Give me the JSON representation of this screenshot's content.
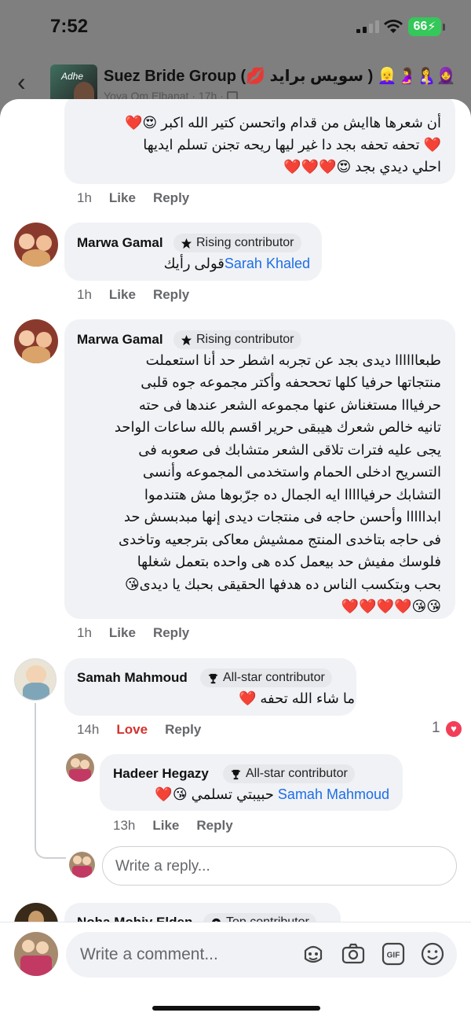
{
  "status": {
    "time": "7:52",
    "battery": "66"
  },
  "group": {
    "title": "Suez Bride Group (💋 سويس برايد ) 👱‍♀️🤰🤱🧕",
    "subtitle": "Yoya Om Elbanat · 17h · ",
    "thumb_text": "Adhe"
  },
  "comments": [
    {
      "lines": [
        "أن شعرها هاايش من قدام واتحسن كتير الله اكبر 😍❤️",
        "❤️ تحفه تحفه بجد دا غير ليها ريحه تجنن تسلم ايديها",
        "احلي ديدي بجد 😍❤️❤️❤️"
      ],
      "time": "1h",
      "like": "Like",
      "reply": "Reply"
    },
    {
      "author": "Marwa Gamal",
      "badge": "Rising contributor",
      "mention": "Sarah Khaled",
      "text": "قولى رأيك",
      "time": "1h",
      "like": "Like",
      "reply": "Reply"
    },
    {
      "author": "Marwa Gamal",
      "badge": "Rising contributor",
      "lines": [
        "طبعاااااا ديدى بجد عن تجربه اشطر حد أنا استعملت",
        "منتجاتها حرفيا كلها تحححفه وأكتر مجموعه جوه قلبى",
        "حرفيااا مستغناش عنها مجموعه الشعر عندها فى حته",
        "تانيه خالص شعرك هيبقى حرير اقسم بالله ساعات الواحد",
        "يجى عليه فترات تلاقى الشعر متشابك فى صعوبه فى",
        "التسريح ادخلى الحمام واستخدمى المجموعه وأنسى",
        "التشابك حرفيااااا ايه الجمال ده جرّبوها مش هتندموا",
        "ابدااااا وأحسن حاجه فى منتجات ديدى إنها مبدبسش حد",
        "فى حاجه بتاخدى المنتج ممشيش معاكى بترجعيه وتاخدى",
        "فلوسك مفيش حد بيعمل كده هى واحده بتعمل شغلها",
        "بحب وبتكسب الناس ده هدفها الحقيقى بحبك يا ديدى😘",
        "😘😘❤️❤️❤️❤️"
      ],
      "time": "1h",
      "like": "Like",
      "reply": "Reply"
    },
    {
      "author": "Samah Mahmoud",
      "badge": "All-star contributor",
      "text": "ما شاء الله تحفه ❤️",
      "time": "14h",
      "like": "Love",
      "reply": "Reply",
      "reactions": "1"
    },
    {
      "author": "Hadeer Hegazy",
      "badge": "All-star contributor",
      "mention": "Samah Mahmoud",
      "text": "حبيبتي تسلمي 😘❤️",
      "time": "13h",
      "like": "Like",
      "reply": "Reply"
    },
    {
      "author": "Noha Mohiy Elden",
      "badge": "Top contributor"
    }
  ],
  "reply_placeholder": "Write a reply...",
  "comment_placeholder": "Write a comment..."
}
